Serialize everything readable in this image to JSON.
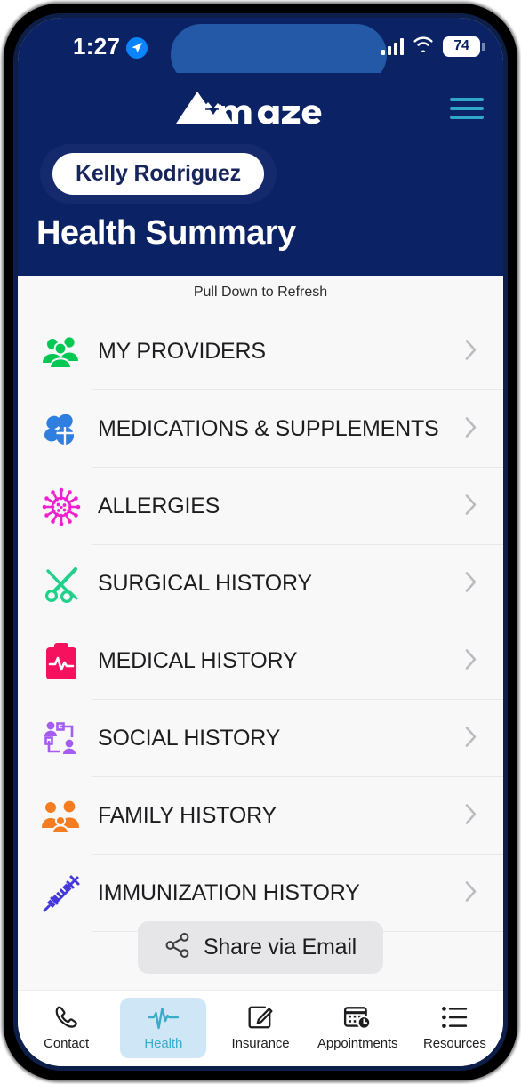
{
  "status_bar": {
    "time": "1:27",
    "location_icon": "location-arrow-icon",
    "signal_icon": "cellular-bars-icon",
    "wifi_icon": "wifi-icon",
    "battery_level": "74"
  },
  "header": {
    "logo_text": "Amaze",
    "logo_icon": "mountain-logo-icon",
    "menu_icon": "hamburger-menu-icon",
    "patient_name": "Kelly Rodriguez",
    "page_title": "Health Summary",
    "background_color": "#0b2265",
    "accent_color": "#2fa8c8"
  },
  "content": {
    "refresh_hint": "Pull Down to Refresh",
    "rows": [
      {
        "label": "MY PROVIDERS",
        "icon": "providers-group-icon",
        "color": "#00c853",
        "chevron": "chevron-right-icon"
      },
      {
        "label": "MEDICATIONS & SUPPLEMENTS",
        "icon": "pills-icon",
        "color": "#2f7fe0",
        "chevron": "chevron-right-icon"
      },
      {
        "label": "ALLERGIES",
        "icon": "allergen-virus-icon",
        "color": "#f020d0",
        "chevron": "chevron-right-icon"
      },
      {
        "label": "SURGICAL HISTORY",
        "icon": "scissors-scalpel-icon",
        "color": "#1fd18a",
        "chevron": "chevron-right-icon"
      },
      {
        "label": "MEDICAL HISTORY",
        "icon": "clipboard-pulse-icon",
        "color": "#f5115e",
        "chevron": "chevron-right-icon"
      },
      {
        "label": "SOCIAL HISTORY",
        "icon": "social-network-icon",
        "color": "#a55cf0",
        "chevron": "chevron-right-icon"
      },
      {
        "label": "FAMILY HISTORY",
        "icon": "family-group-icon",
        "color": "#f57c1f",
        "chevron": "chevron-right-icon"
      },
      {
        "label": "IMMUNIZATION HISTORY",
        "icon": "syringe-icon",
        "color": "#4438d8",
        "chevron": "chevron-right-icon"
      }
    ],
    "share_button": {
      "label": "Share via Email",
      "icon": "share-network-icon"
    }
  },
  "tab_bar": {
    "active_index": 1,
    "active_color": "#3aacc9",
    "active_pill_color": "#cfe6f7",
    "tabs": [
      {
        "label": "Contact",
        "icon": "phone-icon"
      },
      {
        "label": "Health",
        "icon": "heartbeat-pulse-icon"
      },
      {
        "label": "Insurance",
        "icon": "square-pencil-icon"
      },
      {
        "label": "Appointments",
        "icon": "calendar-clock-icon"
      },
      {
        "label": "Resources",
        "icon": "list-bullet-icon"
      }
    ]
  }
}
